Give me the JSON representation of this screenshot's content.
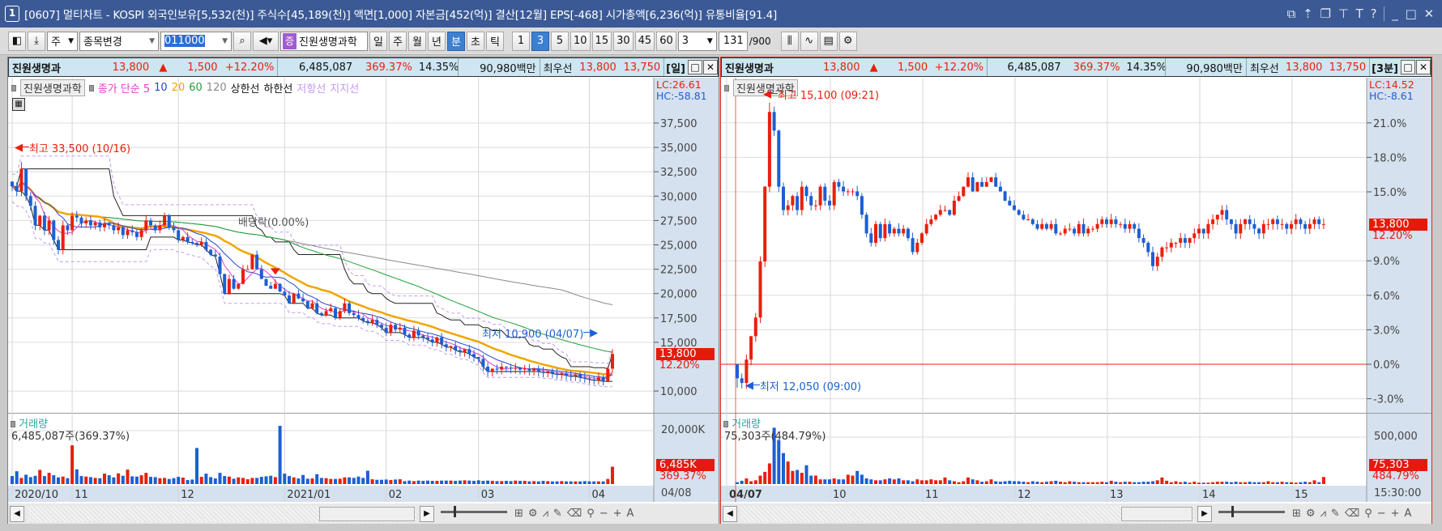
{
  "window": {
    "num": "1",
    "title": "[0607] 멀티차트 - KOSPI 외국인보유[5,532(천)] 주식수[45,189(천)] 액면[1,000] 자본금[452(억)] 결산[12월] EPS[-468] 시가총액[6,236(억)] 유통비율[91.4]",
    "controls": [
      "restore-down-icon",
      "send-back-icon",
      "window-icon",
      "pin-icon",
      "font-icon",
      "help-icon",
      "minimize-icon",
      "maximize-icon",
      "close-icon"
    ]
  },
  "toolbar": {
    "market": "주",
    "change_stock": "종목변경",
    "code": "011000",
    "badge": "증",
    "stock_name": "진원생명과학",
    "periods": [
      "일",
      "주",
      "월",
      "년"
    ],
    "intervals": [
      "분",
      "초",
      "틱"
    ],
    "active_interval": "분",
    "minutes": [
      "1",
      "3",
      "5",
      "10",
      "15",
      "30",
      "45",
      "60"
    ],
    "active_minute": "3",
    "custom_minutes": "3",
    "bar_count": "131",
    "bar_max": "/900"
  },
  "panels": [
    {
      "name": "진원생명과",
      "price": "13,800",
      "arrow": "▲",
      "change": "1,500",
      "change_pct": "+12.20%",
      "volume": "6,485,087",
      "volume_ratio": "369.37%",
      "turnover": "14.35%",
      "amount": "90,980백만",
      "best_label": "최우선",
      "ask": "13,800",
      "bid": "13,750",
      "period": "[일]",
      "legend": {
        "stock": "진원생명과학",
        "ma_label": "종가 단순 5",
        "ma10": "10",
        "ma20": "20",
        "ma60": "60",
        "ma120": "120",
        "upper": "상한선",
        "lower": "하한선",
        "resistance": "저항선",
        "support": "지지선"
      },
      "lc": "LC:26.61",
      "hc": "HC:-58.81",
      "price_tag": "13,800",
      "pct_tag": "12.20%",
      "annotations": {
        "high": "최고 33,500 (10/16)",
        "low": "최저 10,900 (04/07)",
        "event": "배당락(0.00%)"
      },
      "volume_panel": {
        "label": "거래량",
        "summary": "6,485,087주(369.37%)",
        "tick": "20,000K",
        "tag": "6,485K",
        "tag_pct": "369.37%"
      },
      "dates": [
        "2020/10",
        "11",
        "12",
        "2021/01",
        "02",
        "03",
        "04"
      ],
      "date_axis": "04/08"
    },
    {
      "name": "진원생명과",
      "price": "13,800",
      "arrow": "▲",
      "change": "1,500",
      "change_pct": "+12.20%",
      "volume": "6,485,087",
      "volume_ratio": "369.37%",
      "turnover": "14.35%",
      "amount": "90,980백만",
      "best_label": "최우선",
      "ask": "13,800",
      "bid": "13,750",
      "period": "[3분]",
      "legend": {
        "stock": "진원생명과학"
      },
      "lc": "LC:14.52",
      "hc": "HC:-8.61",
      "price_tag": "13,800",
      "pct_tag": "12.20%",
      "annotations": {
        "high": "최고 15,100 (09:21)",
        "low": "최저 12,050 (09:00)"
      },
      "volume_panel": {
        "label": "거래량",
        "summary": "75,303주(484.79%)",
        "tick": "500,000",
        "tag": "75,303",
        "tag_pct": "484.79%"
      },
      "dates": [
        "04/07",
        "10",
        "11",
        "12",
        "13",
        "14",
        "15"
      ],
      "date_axis": "15:30:00"
    }
  ],
  "chart_data": [
    {
      "type": "candlestick",
      "interval": "daily",
      "first_open": 31500,
      "high": {
        "value": 33500,
        "bar": 2
      },
      "low": {
        "value": 10900,
        "bar": 129
      },
      "y_ticks": [
        "37,500",
        "35,000",
        "32,500",
        "30,000",
        "27,500",
        "25,000",
        "22,500",
        "20,000",
        "17,500",
        "15,000",
        "10,000"
      ],
      "moving_averages": [
        5,
        10,
        20,
        60,
        120
      ],
      "closes": [
        31000,
        30500,
        32800,
        30000,
        29000,
        27000,
        28000,
        26500,
        27500,
        25500,
        24500,
        27000,
        26500,
        28000,
        27800,
        27200,
        27500,
        27000,
        27300,
        26800,
        27200,
        27000,
        26500,
        26800,
        26000,
        26500,
        26300,
        25800,
        26500,
        27500,
        27000,
        26500,
        27000,
        28000,
        26800,
        26500,
        25500,
        25800,
        25300,
        25200,
        25000,
        25300,
        24500,
        24000,
        23800,
        22000,
        20000,
        21500,
        20500,
        21000,
        22500,
        22500,
        24000,
        22500,
        21500,
        20800,
        20500,
        21000,
        20200,
        19800,
        19000,
        20000,
        19500,
        19200,
        18500,
        19000,
        18000,
        17800,
        18200,
        18500,
        17500,
        18200,
        19000,
        18000,
        17800,
        17500,
        17200,
        17000,
        17300,
        16800,
        16500,
        16000,
        16800,
        16300,
        16500,
        15800,
        15500,
        16200,
        15700,
        15500,
        15300,
        15000,
        15500,
        14800,
        14500,
        14600,
        14200,
        14000,
        14300,
        13800,
        13500,
        13300,
        12500,
        12000,
        12300,
        12200,
        12500,
        12400,
        12300,
        12400,
        12200,
        12300,
        12100,
        12300,
        12000,
        11900,
        12000,
        11800,
        11700,
        11800,
        11600,
        11500,
        11700,
        11400,
        11300,
        11200,
        11100,
        11400,
        11000,
        12300,
        13800
      ],
      "volumes_k": [
        3000,
        4800,
        2300,
        3500,
        2600,
        3100,
        5300,
        3000,
        4200,
        3300,
        2500,
        2800,
        2200,
        14500,
        5500,
        3000,
        2800,
        2600,
        2300,
        2200,
        3900,
        3300,
        2500,
        4000,
        3100,
        5400,
        2900,
        2800,
        3300,
        4200,
        2700,
        2600,
        2200,
        2300,
        1900,
        2200,
        2700,
        2400,
        1500,
        1700,
        13500,
        2700,
        3900,
        2600,
        2100,
        4200,
        3000,
        2800,
        2000,
        2500,
        2300,
        1800,
        2300,
        2300,
        2700,
        2900,
        3100,
        2600,
        21800,
        3900,
        3000,
        2500,
        2100,
        3400,
        2000,
        2100,
        3700,
        2300,
        2200,
        1900,
        1900,
        2000,
        2500,
        2500,
        2300,
        2800,
        2300,
        5000,
        1800,
        1600,
        1600,
        1700,
        1500,
        1700,
        1800,
        1100,
        1300,
        1100,
        1300,
        1200,
        1300,
        1200,
        1200,
        1300,
        1300,
        1300,
        1200,
        1300,
        1400,
        1300,
        1200,
        1400,
        1200,
        1300,
        1200,
        1100,
        1100,
        1200,
        1100,
        1300,
        1200,
        1200,
        1000,
        1100,
        1000,
        1200,
        1100,
        1000,
        1000,
        1100,
        1000,
        1000,
        1000,
        1000,
        1100,
        1000,
        1000,
        1000,
        1000,
        1900,
        6485
      ]
    },
    {
      "type": "candlestick",
      "interval": "3-minute",
      "first_open": 12300,
      "prev_close": 12300,
      "high": {
        "value": 15100,
        "bar": 7
      },
      "low": {
        "value": 12050,
        "bar": 0
      },
      "y_ticks": [
        "21.0%",
        "18.0%",
        "15.0%",
        "9.0%",
        "6.0%",
        "3.0%",
        "0.0%",
        "-3.0%"
      ],
      "closes": [
        12150,
        12100,
        12350,
        12600,
        12800,
        13400,
        14200,
        15000,
        14800,
        14200,
        13950,
        14000,
        14100,
        13950,
        14200,
        14100,
        14000,
        14000,
        14200,
        14050,
        14000,
        14250,
        14200,
        14150,
        14150,
        14150,
        14100,
        13900,
        13700,
        13600,
        13800,
        13650,
        13800,
        13700,
        13750,
        13700,
        13750,
        13650,
        13500,
        13600,
        13700,
        13800,
        13850,
        13900,
        13950,
        13950,
        13900,
        14050,
        14100,
        14200,
        14300,
        14150,
        14250,
        14200,
        14250,
        14300,
        14200,
        14150,
        14050,
        14000,
        13950,
        13900,
        13850,
        13850,
        13800,
        13750,
        13800,
        13750,
        13800,
        13700,
        13700,
        13750,
        13750,
        13700,
        13800,
        13700,
        13750,
        13750,
        13800,
        13850,
        13800,
        13850,
        13800,
        13800,
        13750,
        13800,
        13750,
        13650,
        13600,
        13500,
        13350,
        13450,
        13550,
        13550,
        13600,
        13600,
        13650,
        13600,
        13650,
        13700,
        13750,
        13700,
        13800,
        13850,
        13900,
        13950,
        13850,
        13800,
        13700,
        13800,
        13850,
        13800,
        13750,
        13700,
        13800,
        13800,
        13850,
        13800,
        13800,
        13750,
        13800,
        13850,
        13800,
        13750,
        13800,
        13850,
        13800,
        13800
      ],
      "volumes": [
        20000,
        35000,
        60000,
        30000,
        40000,
        90000,
        130000,
        220000,
        600000,
        470000,
        330000,
        240000,
        140000,
        150000,
        120000,
        200000,
        90000,
        90000,
        50000,
        50000,
        50000,
        60000,
        50000,
        50000,
        100000,
        90000,
        140000,
        100000,
        60000,
        50000,
        40000,
        40000,
        50000,
        60000,
        50000,
        60000,
        40000,
        40000,
        30000,
        50000,
        40000,
        40000,
        50000,
        40000,
        40000,
        70000,
        40000,
        30000,
        20000,
        30000,
        70000,
        50000,
        40000,
        25000,
        30000,
        50000,
        30000,
        25000,
        30000,
        35000,
        30000,
        30000,
        25000,
        20000,
        30000,
        25000,
        20000,
        25000,
        30000,
        35000,
        25000,
        20000,
        30000,
        25000,
        20000,
        20000,
        20000,
        20000,
        20000,
        25000,
        20000,
        35000,
        25000,
        20000,
        25000,
        25000,
        20000,
        20000,
        25000,
        25000,
        30000,
        40000,
        70000,
        35000,
        20000,
        30000,
        20000,
        25000,
        15000,
        25000,
        15000,
        15000,
        15000,
        20000,
        25000,
        25000,
        25000,
        20000,
        25000,
        20000,
        20000,
        25000,
        20000,
        20000,
        20000,
        30000,
        20000,
        20000,
        25000,
        20000,
        20000,
        15000,
        20000,
        25000,
        20000,
        40000,
        20000,
        75303
      ]
    }
  ],
  "colors": {
    "up": "#e8200c",
    "down": "#1d5fd3",
    "ma5": "#e83ec8",
    "ma10": "#2b45c8",
    "ma20": "#f0a500",
    "ma60": "#1fa03a",
    "ma120": "#8a8a8a",
    "channel": "#222222",
    "envelope": "#c49af0",
    "title_bar": "#3b5a95",
    "axis_bg": "#d5e1ee"
  }
}
